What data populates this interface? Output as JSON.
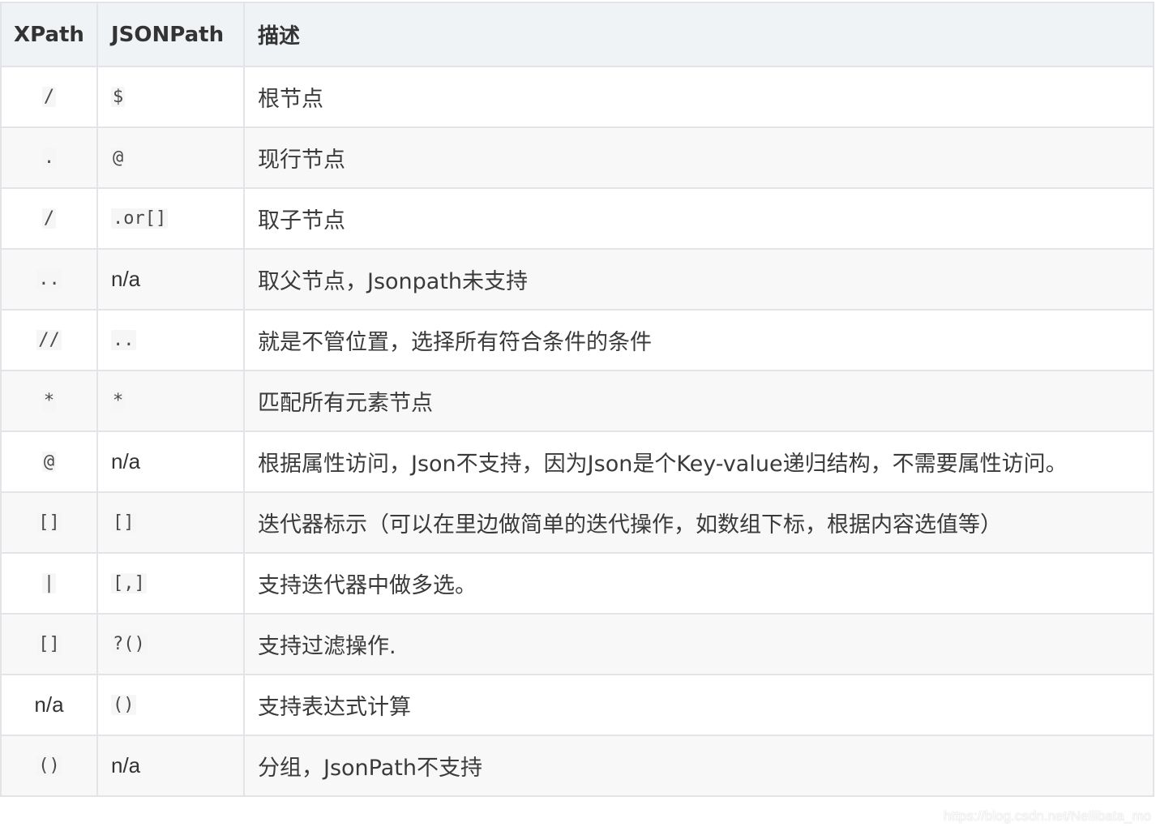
{
  "table": {
    "headers": [
      "XPath",
      "JSONPath",
      "描述"
    ],
    "rows": [
      {
        "xpath": "/",
        "xpath_code": true,
        "jsonpath": "$",
        "jsonpath_code": true,
        "desc": "根节点"
      },
      {
        "xpath": ".",
        "xpath_code": true,
        "jsonpath": "@",
        "jsonpath_code": true,
        "desc": "现行节点"
      },
      {
        "xpath": "/",
        "xpath_code": true,
        "jsonpath": ".or[]",
        "jsonpath_code": true,
        "desc": "取子节点"
      },
      {
        "xpath": "..",
        "xpath_code": true,
        "jsonpath": "n/a",
        "jsonpath_code": false,
        "desc": "取父节点，Jsonpath未支持"
      },
      {
        "xpath": "//",
        "xpath_code": true,
        "jsonpath": "..",
        "jsonpath_code": true,
        "desc": "就是不管位置，选择所有符合条件的条件"
      },
      {
        "xpath": "*",
        "xpath_code": true,
        "jsonpath": "*",
        "jsonpath_code": true,
        "desc": "匹配所有元素节点"
      },
      {
        "xpath": "@",
        "xpath_code": true,
        "jsonpath": "n/a",
        "jsonpath_code": false,
        "desc": "根据属性访问，Json不支持，因为Json是个Key-value递归结构，不需要属性访问。"
      },
      {
        "xpath": "[]",
        "xpath_code": true,
        "jsonpath": "[]",
        "jsonpath_code": true,
        "desc": "迭代器标示（可以在里边做简单的迭代操作，如数组下标，根据内容选值等）"
      },
      {
        "xpath": "|",
        "xpath_code": true,
        "jsonpath": "[,]",
        "jsonpath_code": true,
        "desc": "支持迭代器中做多选。"
      },
      {
        "xpath": "[]",
        "xpath_code": true,
        "jsonpath": "?()",
        "jsonpath_code": true,
        "desc": "支持过滤操作."
      },
      {
        "xpath": "n/a",
        "xpath_code": false,
        "jsonpath": "()",
        "jsonpath_code": true,
        "desc": "支持表达式计算"
      },
      {
        "xpath": "()",
        "xpath_code": true,
        "jsonpath": "n/a",
        "jsonpath_code": false,
        "desc": "分组，JsonPath不支持"
      }
    ]
  },
  "watermark": "https://blog.csdn.net/Nellibata_mo",
  "colors": {
    "header_bg": "#eff3f5",
    "stripe_bg": "#f8f8f8",
    "border": "#e2e4e8"
  }
}
